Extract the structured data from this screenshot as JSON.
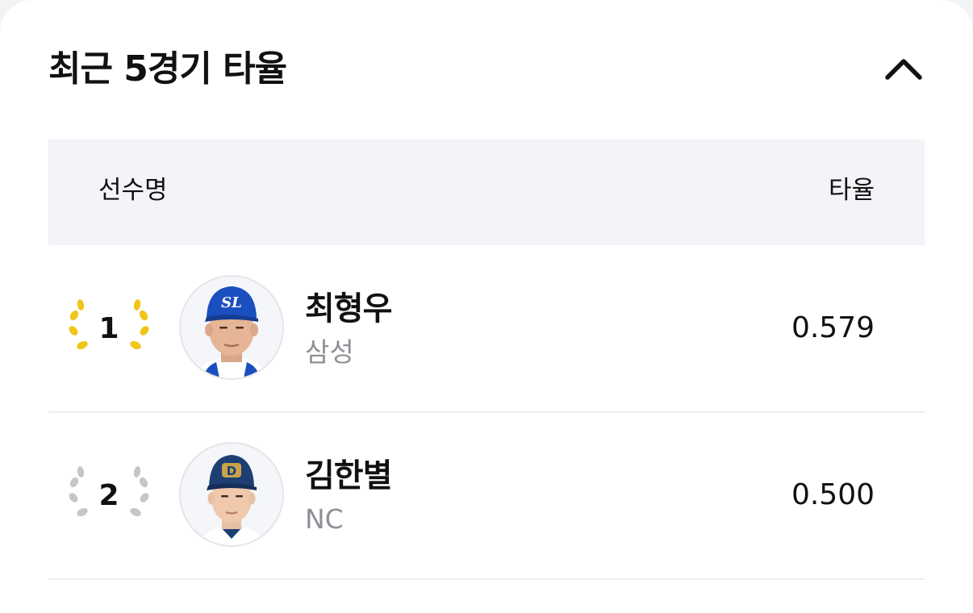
{
  "card": {
    "title": "최근 5경기 타율"
  },
  "table": {
    "col_player": "선수명",
    "col_avg": "타율"
  },
  "rows": [
    {
      "rank": "1",
      "badge_color": "#f0c419",
      "name": "최형우",
      "team": "삼성",
      "avg": "0.579",
      "cap_color": "#1b4fbf",
      "cap_logo_icon": "samsung-lions-logo-icon",
      "logo_text": "SL"
    },
    {
      "rank": "2",
      "badge_color": "#c4c6c9",
      "name": "김한별",
      "team": "NC",
      "avg": "0.500",
      "cap_color": "#1d3f74",
      "cap_logo_icon": "nc-dinos-logo-icon",
      "logo_text": "D"
    }
  ]
}
